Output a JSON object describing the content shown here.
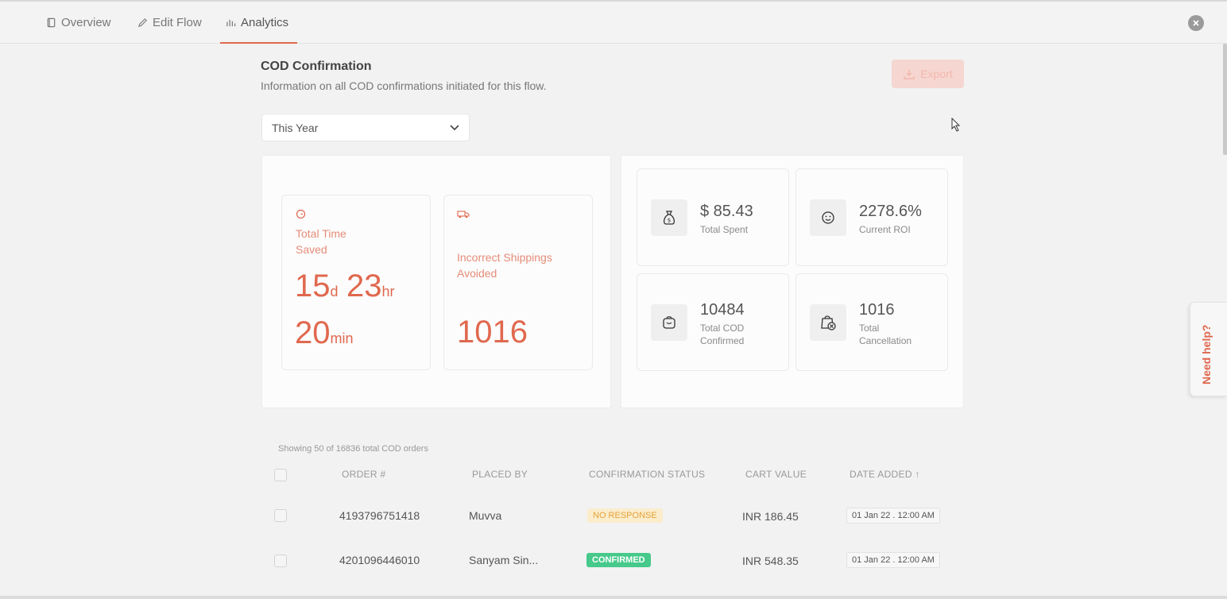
{
  "tabs": [
    {
      "label": "Overview",
      "icon": "book-icon"
    },
    {
      "label": "Edit Flow",
      "icon": "pencil-icon"
    },
    {
      "label": "Analytics",
      "icon": "bar-chart-icon",
      "active": true
    }
  ],
  "header": {
    "title": "COD Confirmation",
    "subtitle": "Information on all COD confirmations initiated for this flow.",
    "export_label": "Export"
  },
  "filter": {
    "selected": "This Year"
  },
  "time_saved": {
    "label_line1": "Total Time",
    "label_line2": "Saved",
    "days": "15",
    "days_unit": "d",
    "hours": "23",
    "hours_unit": "hr",
    "minutes": "20",
    "minutes_unit": "min"
  },
  "shipping": {
    "label_line1": "Incorrect Shippings",
    "label_line2": "Avoided",
    "value": "1016"
  },
  "metrics": [
    {
      "value": "$ 85.43",
      "label_line1": "Total Spent",
      "label_line2": "",
      "icon": "money-bag-icon"
    },
    {
      "value": "2278.6%",
      "label_line1": "Current ROI",
      "label_line2": "",
      "icon": "smiley-icon"
    },
    {
      "value": "10484",
      "label_line1": "Total COD",
      "label_line2": "Confirmed",
      "icon": "shopping-bag-smile-icon"
    },
    {
      "value": "1016",
      "label_line1": "Total",
      "label_line2": "Cancellation",
      "icon": "bag-cancel-icon"
    }
  ],
  "table": {
    "showing": "Showing 50 of 16836 total COD orders",
    "columns": [
      "ORDER #",
      "PLACED BY",
      "CONFIRMATION STATUS",
      "CART VALUE",
      "DATE ADDED ↑"
    ],
    "rows": [
      {
        "order": "4193796751418",
        "placed_by": "Muvva",
        "status": "NO RESPONSE",
        "cart": "INR 186.45",
        "date": "01 Jan 22 . 12:00 AM"
      },
      {
        "order": "4201096446010",
        "placed_by": "Sanyam Sin...",
        "status": "CONFIRMED",
        "cart": "INR 548.35",
        "date": "01 Jan 22 . 12:00 AM"
      }
    ]
  },
  "help": {
    "label": "Need help?"
  },
  "colors": {
    "accent": "#e0684e",
    "confirmed": "#46c98a",
    "no_response": "#e4a23a"
  }
}
